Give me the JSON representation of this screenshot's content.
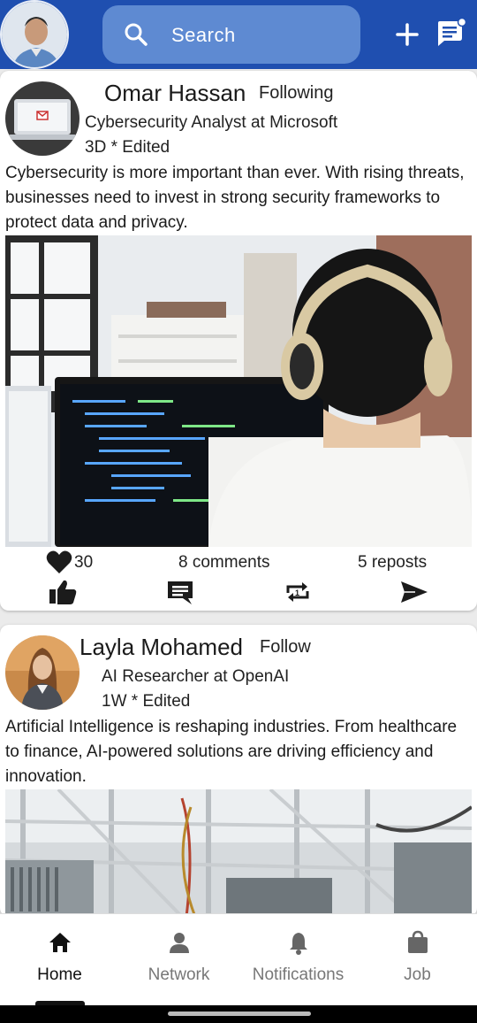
{
  "header": {
    "search_placeholder": "Search",
    "icons": [
      "avatar",
      "search-icon",
      "plus-icon",
      "message-icon"
    ],
    "colors": {
      "bar": "#1f4fb0",
      "search_bg": "#5e8ad2"
    }
  },
  "posts": [
    {
      "author": "Omar Hassan",
      "follow_label": "Following",
      "title": "Cybersecurity Analyst at Microsoft",
      "time": "3D * Edited",
      "body": "Cybersecurity is more important than ever. With rising threats, businesses need to invest in strong security frameworks to protect data and privacy.",
      "likes": "30",
      "comments": "8 comments",
      "reposts": "5 reposts"
    },
    {
      "author": "Layla Mohamed",
      "follow_label": "Follow",
      "title": "AI Researcher at OpenAI",
      "time": "1W * Edited",
      "body": "Artificial Intelligence is reshaping industries. From healthcare to finance, AI-powered solutions are driving efficiency and innovation."
    }
  ],
  "nav": {
    "items": [
      {
        "label": "Home",
        "icon": "home-icon",
        "active": true
      },
      {
        "label": "Network",
        "icon": "person-icon"
      },
      {
        "label": "Notifications",
        "icon": "bell-icon"
      },
      {
        "label": "Job",
        "icon": "bag-icon"
      }
    ]
  }
}
